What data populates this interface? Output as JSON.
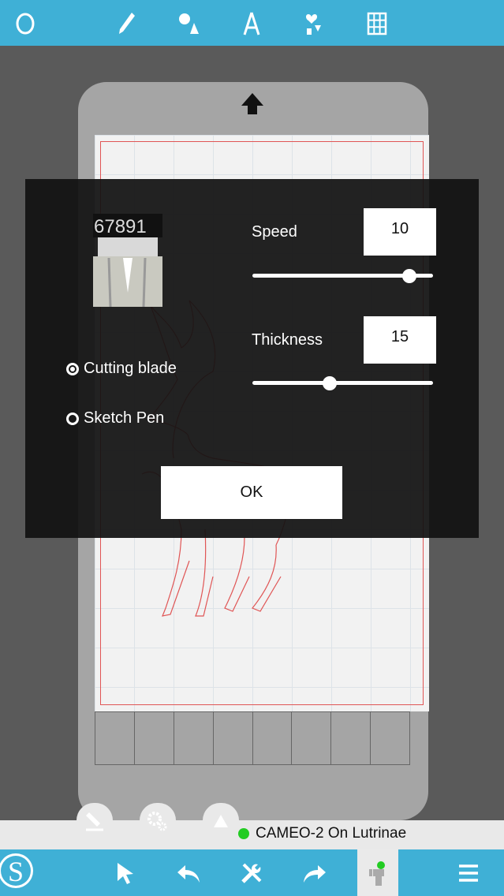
{
  "colors": {
    "accent": "#3fb0d6",
    "cut_line": "#e05555",
    "status_green": "#22cc22"
  },
  "toolbar": {
    "icons": [
      "circle-icon",
      "pencil-icon",
      "shapes-icon",
      "text-icon",
      "clipart-icon",
      "grid-icon"
    ]
  },
  "dialog": {
    "speed_label": "Speed",
    "speed_value": "10",
    "speed_level": 0.9,
    "thickness_label": "Thickness",
    "thickness_value": "15",
    "thickness_level": 0.42,
    "blade_numbers": "67891",
    "tools": [
      {
        "label": "Cutting blade",
        "selected": true
      },
      {
        "label": "Sketch Pen",
        "selected": false
      }
    ],
    "ok_label": "OK"
  },
  "status": {
    "connection": "CAMEO-2 On Lutrinae"
  },
  "bottombar": {
    "logo_letter": "S",
    "icons": [
      "select-arrow-icon",
      "undo-icon",
      "tools-icon",
      "redo-icon",
      "cutter-icon",
      "menu-icon"
    ]
  }
}
